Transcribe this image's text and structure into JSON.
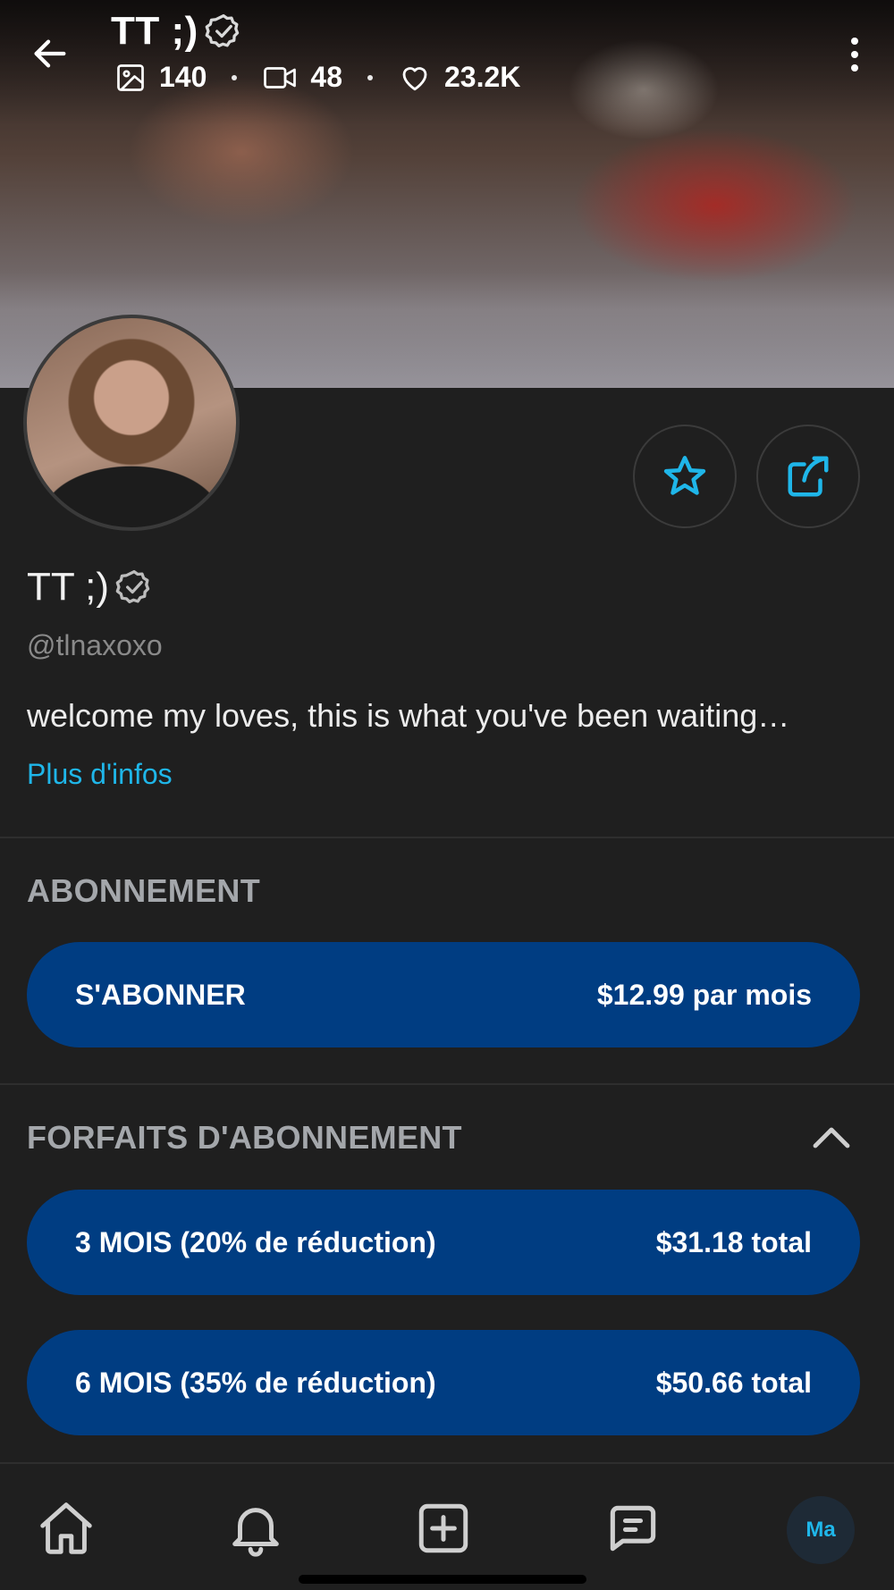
{
  "header": {
    "title": "TT ;)",
    "stats": {
      "photos": "140",
      "videos": "48",
      "likes": "23.2K"
    }
  },
  "profile": {
    "name": "TT ;)",
    "handle": "@tlnaxoxo",
    "bio": "welcome my loves, this is what you've been waiting…",
    "more_link": "Plus d'infos"
  },
  "subscription": {
    "section_title": "ABONNEMENT",
    "button_label": "S'ABONNER",
    "button_price": "$12.99 par mois"
  },
  "bundles": {
    "section_title": "FORFAITS D'ABONNEMENT",
    "items": [
      {
        "label": "3 MOIS (20% de réduction)",
        "price": "$31.18 total"
      },
      {
        "label": "6 MOIS (35% de réduction)",
        "price": "$50.66 total"
      }
    ]
  },
  "nav": {
    "avatar_initials": "Ma"
  },
  "colors": {
    "accent": "#1fb6e9",
    "pill": "#003d82",
    "background": "#1f1f1f"
  },
  "icons": [
    "back-arrow-icon",
    "verified-icon",
    "image-icon",
    "video-icon",
    "heart-icon",
    "more-vertical-icon",
    "star-icon",
    "share-icon",
    "chevron-up-icon",
    "home-icon",
    "bell-icon",
    "add-square-icon",
    "message-icon"
  ]
}
